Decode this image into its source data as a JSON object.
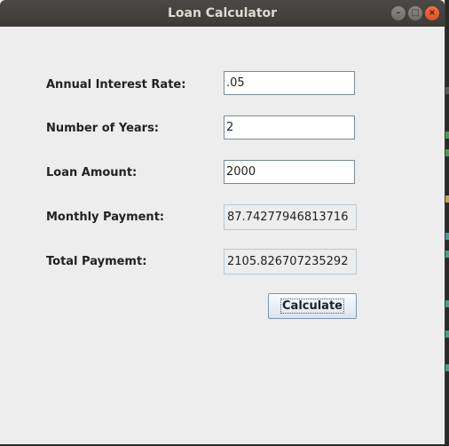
{
  "window": {
    "title": "Loan Calculator",
    "controls": {
      "minimize": "–",
      "maximize": "□",
      "close": "×"
    }
  },
  "form": {
    "interest_label": "Annual Interest Rate:",
    "interest_value": ".05",
    "years_label": "Number of Years:",
    "years_value": "2",
    "amount_label": "Loan Amount:",
    "amount_value": "2000",
    "monthly_label": "Monthly Payment:",
    "monthly_value": "87.74277946813716",
    "total_label": "Total Paymemt:",
    "total_value": "2105.826707235292",
    "calculate_label": "Calculate"
  }
}
